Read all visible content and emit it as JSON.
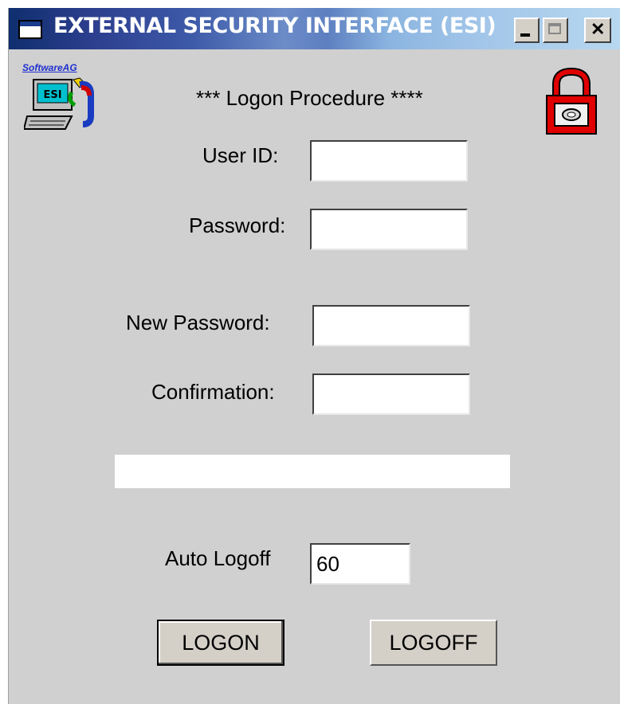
{
  "window": {
    "title": "EXTERNAL SECURITY INTERFACE (ESI)"
  },
  "brand": {
    "text": "SoftwareAG",
    "icon_label": "ESI"
  },
  "form": {
    "heading": "*** Logon Procedure ****",
    "user_id_label": "User ID:",
    "user_id_value": "",
    "password_label": "Password:",
    "password_value": "",
    "new_password_label": "New Password:",
    "new_password_value": "",
    "confirmation_label": "Confirmation:",
    "confirmation_value": "",
    "message": "",
    "auto_logoff_label": "Auto Logoff",
    "auto_logoff_value": "60"
  },
  "buttons": {
    "logon": "LOGON",
    "logoff": "LOGOFF"
  },
  "icons": {
    "app": "window-icon",
    "brand": "esi-computer-icon",
    "lock": "padlock-icon"
  },
  "colors": {
    "background": "#d0d0d0",
    "lock": "#e00000",
    "title_start": "#0f2f6e",
    "title_end": "#b8d8f0"
  }
}
